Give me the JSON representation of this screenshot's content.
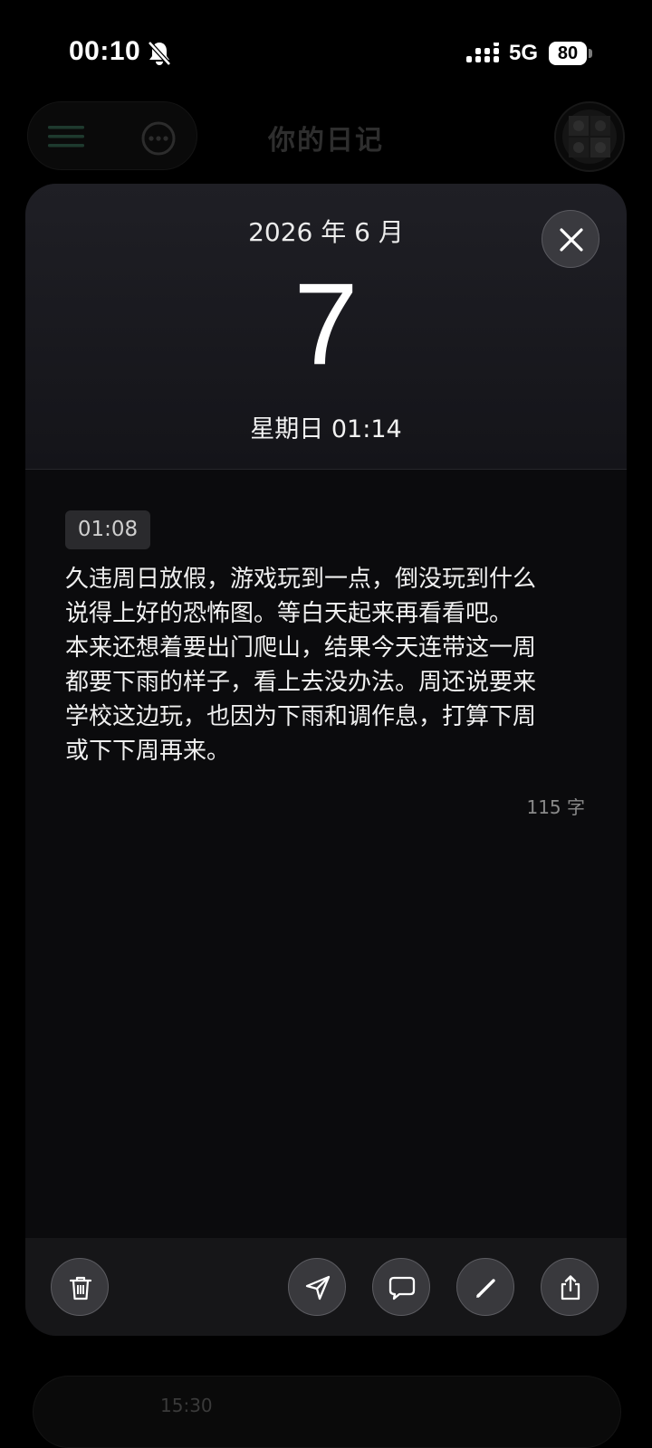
{
  "status_bar": {
    "time": "00:10",
    "network": "5G",
    "battery": "80",
    "icons": [
      "bell-slash-icon",
      "signal-icon"
    ]
  },
  "header": {
    "title": "你的日记",
    "icons": [
      "menu-icon",
      "more-icon"
    ]
  },
  "entry": {
    "month": "2026 年 6 月",
    "day": "7",
    "weekday_time": "星期日  01:14",
    "time_badge": "01:08",
    "body": "久违周日放假，游戏玩到一点，倒没玩到什么\n说得上好的恐怖图。等白天起来再看看吧。\n本来还想着要出门爬山，结果今天连带这一周\n都要下雨的样子，看上去没办法。周还说要来\n学校这边玩，也因为下雨和调作息，打算下周\n或下下周再来。",
    "word_count": "115 字"
  },
  "toolbar": {
    "buttons": [
      "trash-icon",
      "send-icon",
      "comment-icon",
      "pencil-icon",
      "share-icon"
    ]
  },
  "next_entry": {
    "time": "15:30"
  },
  "colors": {
    "background": "#000000",
    "card": "#0b0b0d",
    "card_header": "#1f1f25",
    "button": "#39393d",
    "menu_accent": "#1e3a2e"
  }
}
